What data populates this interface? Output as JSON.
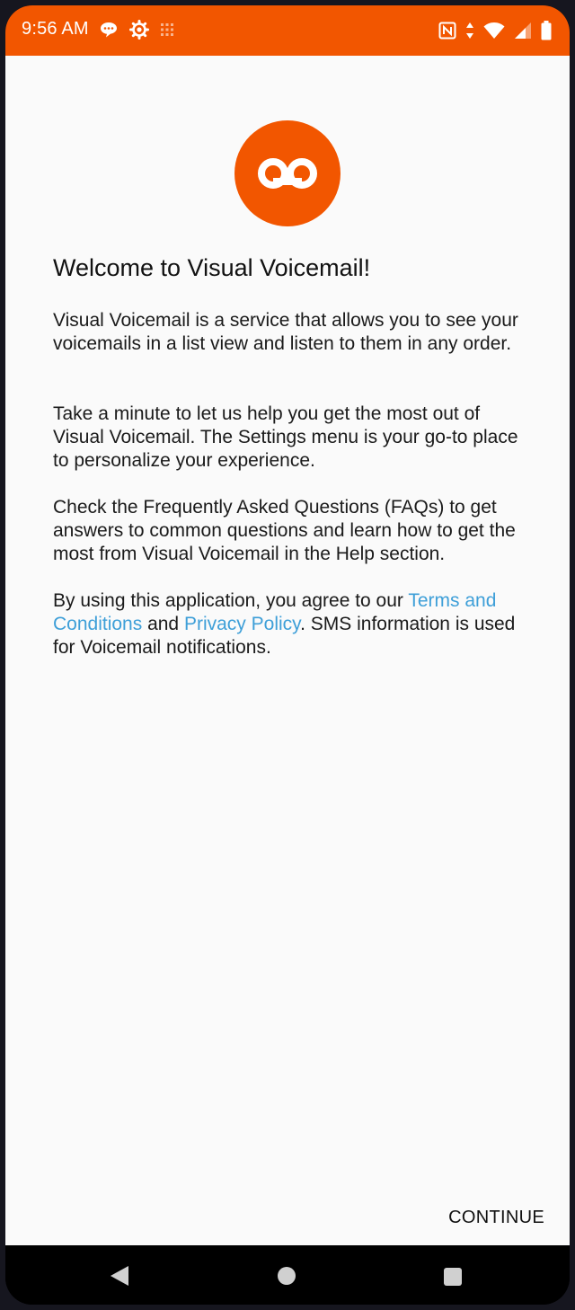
{
  "status_bar": {
    "time": "9:56 AM",
    "icons_left": [
      "chat-icon",
      "gear-icon",
      "grid-icon"
    ],
    "icons_right": [
      "nfc-icon",
      "data-arrows-icon",
      "wifi-icon",
      "signal-icon",
      "battery-icon"
    ],
    "background_color": "#f25600"
  },
  "logo": {
    "icon": "voicemail-icon",
    "color": "#f25600"
  },
  "welcome": {
    "title": "Welcome to Visual Voicemail!",
    "paragraph1": "Visual Voicemail is a service that allows you to see your voicemails in a list view and listen to them in any order.",
    "paragraph2": "Take a minute to let us help you get the most out of Visual Voicemail. The Settings menu is your go-to place to personalize your experience.",
    "paragraph3": "Check the Frequently Asked Questions (FAQs) to get answers to common questions and learn how to get the most from Visual Voicemail in the Help section.",
    "paragraph4": {
      "before": "By using this application, you agree to our ",
      "terms_link": "Terms and Conditions",
      "middle": " and ",
      "privacy_link": "Privacy Policy",
      "after": ". SMS information is used for Voicemail notifications."
    },
    "link_color": "#3e9fd8"
  },
  "actions": {
    "continue_label": "CONTINUE"
  },
  "nav_bar": {
    "icons": [
      "back-icon",
      "home-icon",
      "recents-icon"
    ]
  }
}
